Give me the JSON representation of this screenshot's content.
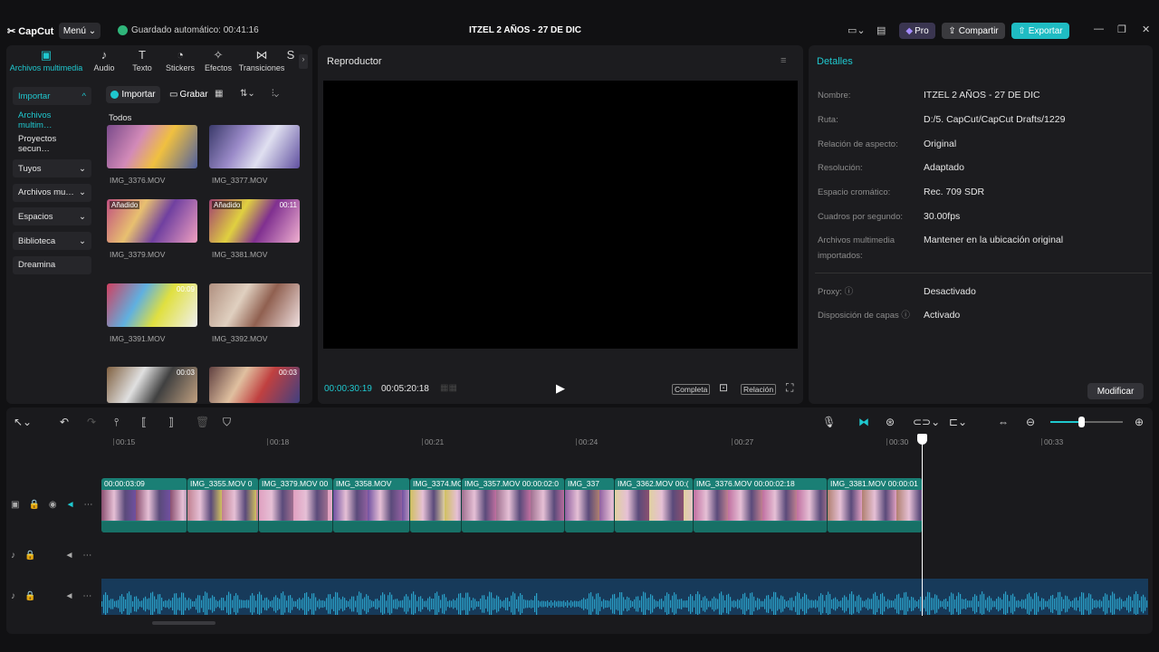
{
  "app": {
    "name": "CapCut",
    "menu_label": "Menú",
    "autosave": "Guardado automático: 00:41:16",
    "project_title": "ITZEL 2 AÑOS - 27 DE DIC",
    "pro_label": "Pro",
    "share_label": "Compartir",
    "export_label": "Exportar"
  },
  "media_tabs": [
    {
      "label": "Archivos multimedia",
      "icon": "media-icon",
      "active": true
    },
    {
      "label": "Audio",
      "icon": "audio-icon"
    },
    {
      "label": "Texto",
      "icon": "text-icon"
    },
    {
      "label": "Stickers",
      "icon": "sticker-icon"
    },
    {
      "label": "Efectos",
      "icon": "effects-icon"
    },
    {
      "label": "Transiciones",
      "icon": "transitions-icon"
    },
    {
      "label": "S",
      "icon": "more-icon"
    }
  ],
  "left_nav": [
    {
      "label": "Importar",
      "chevron": "^"
    },
    {
      "label": "Archivos multim…",
      "chevron": ""
    },
    {
      "label": "Proyectos secun…",
      "chevron": ""
    },
    {
      "label": "Tuyos",
      "chevron": "⌄"
    },
    {
      "label": "Archivos mu…",
      "chevron": "⌄"
    },
    {
      "label": "Espacios",
      "chevron": "⌄"
    },
    {
      "label": "Biblioteca",
      "chevron": "⌄"
    },
    {
      "label": "Dreamina",
      "chevron": ""
    }
  ],
  "media_toolbar": {
    "import_label": "Importar",
    "record_label": "Grabar"
  },
  "media_section": "Todos",
  "media_items": [
    {
      "name": "IMG_3376.MOV",
      "badge": "",
      "duration": ""
    },
    {
      "name": "IMG_3377.MOV",
      "badge": "",
      "duration": ""
    },
    {
      "name": "IMG_3379.MOV",
      "badge": "Añadido",
      "duration": ""
    },
    {
      "name": "IMG_3381.MOV",
      "badge": "Añadido",
      "duration": "00:11"
    },
    {
      "name": "IMG_3391.MOV",
      "badge": "",
      "duration": "00:09"
    },
    {
      "name": "IMG_3392.MOV",
      "badge": "",
      "duration": ""
    },
    {
      "name": "",
      "badge": "",
      "duration": "00:03"
    },
    {
      "name": "",
      "badge": "",
      "duration": "00:03"
    }
  ],
  "player": {
    "title": "Reproductor",
    "current_time": "00:00:30:19",
    "total_time": "00:05:20:18",
    "full_label": "Completa",
    "ratio_label": "Relación"
  },
  "details": {
    "title": "Detalles",
    "rows": [
      {
        "label": "Nombre:",
        "value": "ITZEL 2 AÑOS - 27 DE DIC"
      },
      {
        "label": "Ruta:",
        "value": "D:/5. CapCut/CapCut Drafts/1229"
      },
      {
        "label": "Relación de aspecto:",
        "value": "Original"
      },
      {
        "label": "Resolución:",
        "value": "Adaptado"
      },
      {
        "label": "Espacio cromático:",
        "value": "Rec. 709 SDR"
      },
      {
        "label": "Cuadros por segundo:",
        "value": "30.00fps"
      },
      {
        "label": "Archivos multimedia importados:",
        "value": "Mantener en la ubicación original"
      }
    ],
    "proxy_label": "Proxy:",
    "proxy_value": "Desactivado",
    "layers_label": "Disposición de capas",
    "layers_value": "Activado",
    "modify_label": "Modificar"
  },
  "timeline": {
    "ruler_labels": [
      "00:15",
      "00:18",
      "00:21",
      "00:24",
      "00:27",
      "00:30",
      "00:33"
    ],
    "clips": [
      {
        "label": "00:00:03:09"
      },
      {
        "label": "IMG_3355.MOV  0"
      },
      {
        "label": "IMG_3379.MOV  00"
      },
      {
        "label": "IMG_3358.MOV"
      },
      {
        "label": "IMG_3374.MC"
      },
      {
        "label": "IMG_3357.MOV  00:00:02:0"
      },
      {
        "label": "IMG_337"
      },
      {
        "label": "IMG_3362.MOV  00:("
      },
      {
        "label": "IMG_3376.MOV  00:00:02:18"
      },
      {
        "label": "IMG_3381.MOV  00:00:01"
      }
    ]
  },
  "colors": {
    "accent": "#1fc8cf",
    "clip": "#1a7f75",
    "audio": "#173a5a"
  }
}
